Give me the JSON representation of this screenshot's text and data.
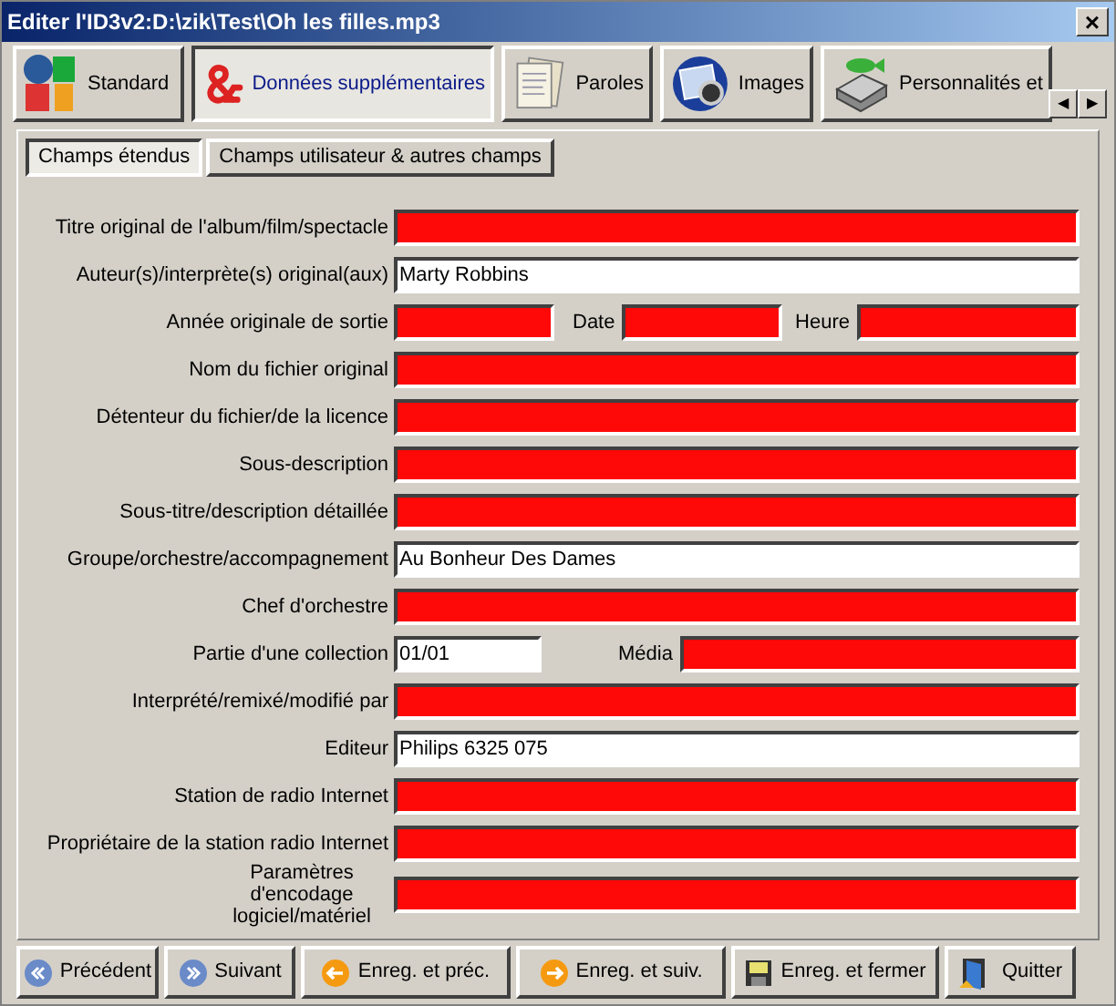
{
  "window": {
    "title": "Editer l'ID3v2:D:\\zik\\Test\\Oh les filles.mp3",
    "close": "×"
  },
  "tabs": [
    {
      "label": "Standard",
      "selected": false
    },
    {
      "label": "Données supplémentaires",
      "selected": true
    },
    {
      "label": "Paroles",
      "selected": false
    },
    {
      "label": "Images",
      "selected": false
    },
    {
      "label": "Personnalités et",
      "selected": false
    }
  ],
  "tab_scroll": [
    "◀",
    "▶"
  ],
  "subtabs": [
    {
      "label": "Champs étendus",
      "selected": true
    },
    {
      "label": "Champs utilisateur & autres champs",
      "selected": false
    }
  ],
  "rows": [
    {
      "kind": "wide",
      "fields": [
        {
          "label": "Titre original de l'album/film/spectacle",
          "empty": true
        }
      ]
    },
    {
      "kind": "wide",
      "fields": [
        {
          "label": "Auteur(s)/interprète(s) original(aux)",
          "value": "Marty Robbins",
          "empty": false
        }
      ]
    },
    {
      "kind": "triple",
      "fields": [
        {
          "label": "Année originale de sortie",
          "empty": true
        },
        {
          "label": "Date",
          "empty": true
        },
        {
          "label": "Heure",
          "empty": true
        }
      ]
    },
    {
      "kind": "wide",
      "fields": [
        {
          "label": "Nom du fichier original",
          "empty": true
        }
      ]
    },
    {
      "kind": "wide",
      "fields": [
        {
          "label": "Détenteur du fichier/de la licence",
          "empty": true
        }
      ]
    },
    {
      "kind": "wide",
      "fields": [
        {
          "label": "Sous-description",
          "empty": true
        }
      ]
    },
    {
      "kind": "wide",
      "fields": [
        {
          "label": "Sous-titre/description détaillée",
          "empty": true
        }
      ]
    },
    {
      "kind": "wide",
      "fields": [
        {
          "label": "Groupe/orchestre/accompagnement",
          "value": "Au Bonheur Des Dames",
          "empty": false
        }
      ]
    },
    {
      "kind": "wide",
      "fields": [
        {
          "label": "Chef d'orchestre",
          "empty": true
        }
      ]
    },
    {
      "kind": "pair",
      "fields": [
        {
          "label": "Partie d'une collection",
          "value": "01/01",
          "empty": false
        },
        {
          "label": "Média",
          "empty": true
        }
      ]
    },
    {
      "kind": "wide",
      "fields": [
        {
          "label": "Interprété/remixé/modifié par",
          "empty": true
        }
      ]
    },
    {
      "kind": "wide",
      "fields": [
        {
          "label": "Editeur",
          "value": "Philips 6325 075",
          "empty": false
        }
      ]
    },
    {
      "kind": "wide",
      "fields": [
        {
          "label": "Station de radio Internet",
          "empty": true
        }
      ]
    },
    {
      "kind": "wide",
      "fields": [
        {
          "label": "Propriétaire de la station radio Internet",
          "empty": true
        }
      ]
    },
    {
      "kind": "wrapped",
      "fields": [
        {
          "label": "Paramètres d'encodage logiciel/matériel",
          "empty": true
        }
      ]
    }
  ],
  "buttons": [
    {
      "label": "Précédent"
    },
    {
      "label": "Suivant"
    },
    {
      "label": "Enreg. et préc."
    },
    {
      "label": "Enreg. et suiv."
    },
    {
      "label": "Enreg. et fermer"
    },
    {
      "label": "Quitter"
    }
  ]
}
